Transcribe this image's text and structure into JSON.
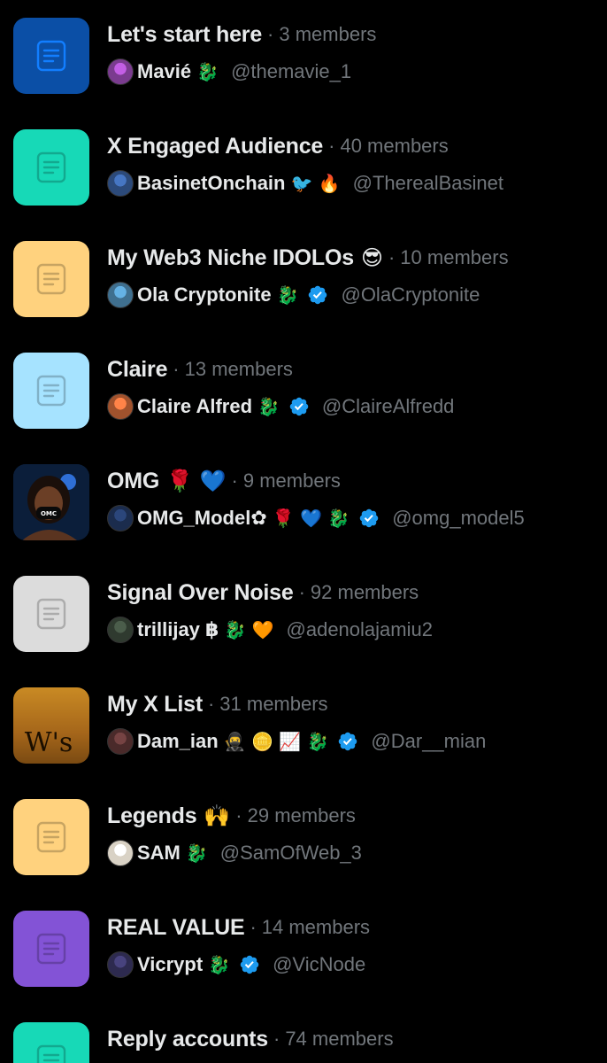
{
  "colors": {
    "background": "#000000",
    "text_primary": "#e7e9ea",
    "text_secondary": "#71767b",
    "verified": "#1d9bf0"
  },
  "lists": [
    {
      "title": "Let's start here",
      "emoji": "",
      "members": "3 members",
      "owner_name": "Mavié",
      "owner_glyphs": "🐉",
      "verified": false,
      "handle": "@themavie_1",
      "thumb_color": "#0b4fa6",
      "thumb_icon": "list-icon"
    },
    {
      "title": "X Engaged Audience",
      "emoji": "",
      "members": "40 members",
      "owner_name": "BasinetOnchain",
      "owner_glyphs": "🐦 🔥",
      "verified": false,
      "handle": "@TherealBasinet",
      "thumb_color": "#17d9b7",
      "thumb_icon": "list-icon"
    },
    {
      "title": "My Web3 Niche IDOLOs",
      "emoji": "😎",
      "members": "10 members",
      "owner_name": "Ola Cryptonite",
      "owner_glyphs": "🐉",
      "verified": true,
      "handle": "@OlaCryptonite",
      "thumb_color": "#ffd27e",
      "thumb_icon": "list-icon"
    },
    {
      "title": "Claire",
      "emoji": "",
      "members": "13 members",
      "owner_name": "Claire Alfred",
      "owner_glyphs": "🐉",
      "verified": true,
      "handle": "@ClaireAlfredd",
      "thumb_color": "#a6e3ff",
      "thumb_icon": "list-icon"
    },
    {
      "title": "OMG",
      "emoji": "🌹 💙",
      "members": "9 members",
      "owner_name": "OMG_Model✿",
      "owner_glyphs": "🌹 💙 🐉",
      "verified": true,
      "handle": "@omg_model5",
      "thumb_color": "#0b1e3a",
      "thumb_icon": "portrait-image"
    },
    {
      "title": "Signal Over Noise",
      "emoji": "",
      "members": "92 members",
      "owner_name": "trillijay ฿",
      "owner_glyphs": "🐉 🧡",
      "verified": false,
      "handle": "@adenolajamiu2",
      "thumb_color": "#dcdcdc",
      "thumb_icon": "list-icon"
    },
    {
      "title": "My X List",
      "emoji": "",
      "members": "31 members",
      "owner_name": "Dam_ian",
      "owner_glyphs": "🥷 🪙 📈 🐉",
      "verified": true,
      "handle": "@Dar__mian",
      "thumb_color": "#b87a1a",
      "thumb_icon": "ws-image",
      "thumb_text": "W's"
    },
    {
      "title": "Legends",
      "emoji": "🙌",
      "members": "29 members",
      "owner_name": "SAM",
      "owner_glyphs": "🐉",
      "verified": false,
      "handle": "@SamOfWeb_3",
      "thumb_color": "#ffd27e",
      "thumb_icon": "list-icon"
    },
    {
      "title": "REAL VALUE",
      "emoji": "",
      "members": "14 members",
      "owner_name": "Vicrypt",
      "owner_glyphs": "🐉",
      "verified": true,
      "handle": "@VicNode",
      "thumb_color": "#8353d6",
      "thumb_icon": "list-icon"
    },
    {
      "title": "Reply accounts",
      "emoji": "",
      "members": "74 members",
      "owner_name": "",
      "owner_glyphs": "",
      "verified": false,
      "handle": "",
      "thumb_color": "#17d9b7",
      "thumb_icon": "list-icon"
    }
  ]
}
